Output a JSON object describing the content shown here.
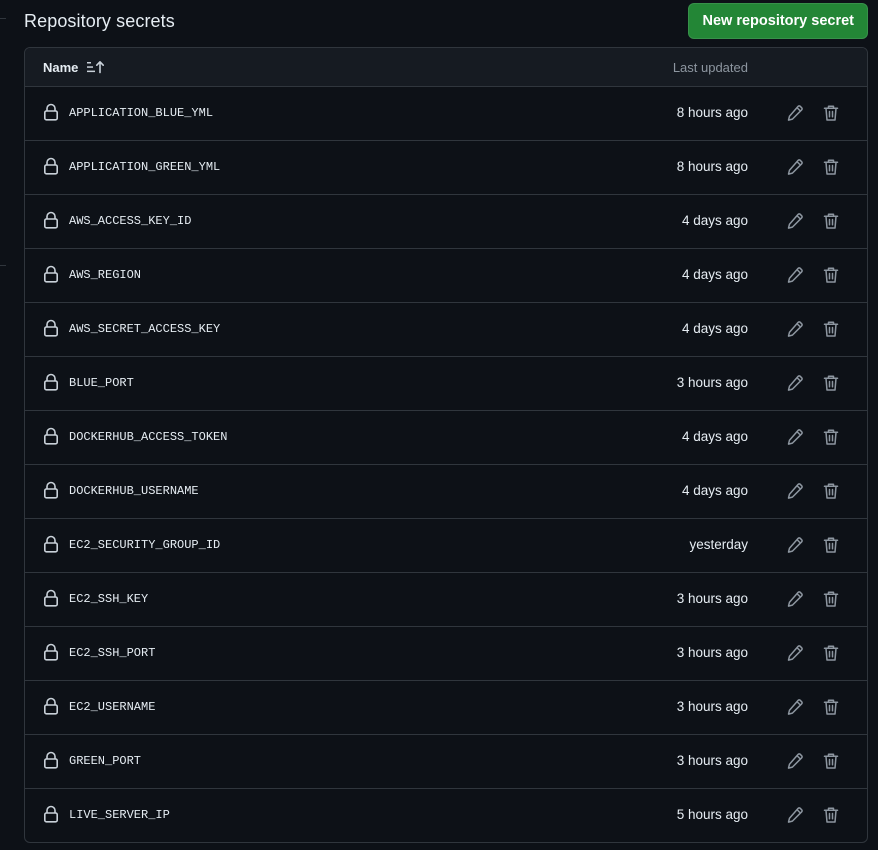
{
  "header": {
    "title": "Repository secrets",
    "new_button_label": "New repository secret"
  },
  "table": {
    "col_name": "Name",
    "col_updated": "Last updated",
    "rows": [
      {
        "name": "APPLICATION_BLUE_YML",
        "updated": "8 hours ago"
      },
      {
        "name": "APPLICATION_GREEN_YML",
        "updated": "8 hours ago"
      },
      {
        "name": "AWS_ACCESS_KEY_ID",
        "updated": "4 days ago"
      },
      {
        "name": "AWS_REGION",
        "updated": "4 days ago"
      },
      {
        "name": "AWS_SECRET_ACCESS_KEY",
        "updated": "4 days ago"
      },
      {
        "name": "BLUE_PORT",
        "updated": "3 hours ago"
      },
      {
        "name": "DOCKERHUB_ACCESS_TOKEN",
        "updated": "4 days ago"
      },
      {
        "name": "DOCKERHUB_USERNAME",
        "updated": "4 days ago"
      },
      {
        "name": "EC2_SECURITY_GROUP_ID",
        "updated": "yesterday"
      },
      {
        "name": "EC2_SSH_KEY",
        "updated": "3 hours ago"
      },
      {
        "name": "EC2_SSH_PORT",
        "updated": "3 hours ago"
      },
      {
        "name": "EC2_USERNAME",
        "updated": "3 hours ago"
      },
      {
        "name": "GREEN_PORT",
        "updated": "3 hours ago"
      },
      {
        "name": "LIVE_SERVER_IP",
        "updated": "5 hours ago"
      }
    ]
  },
  "icons": {
    "lock": "lock-icon",
    "edit": "pencil-icon",
    "delete": "trash-icon",
    "sort": "sort-ascending-icon"
  },
  "colors": {
    "background": "#0d1117",
    "header_bg": "#161b22",
    "border": "#30363d",
    "primary_button": "#238636",
    "text": "#e6edf3",
    "muted_text": "#8d96a0"
  }
}
